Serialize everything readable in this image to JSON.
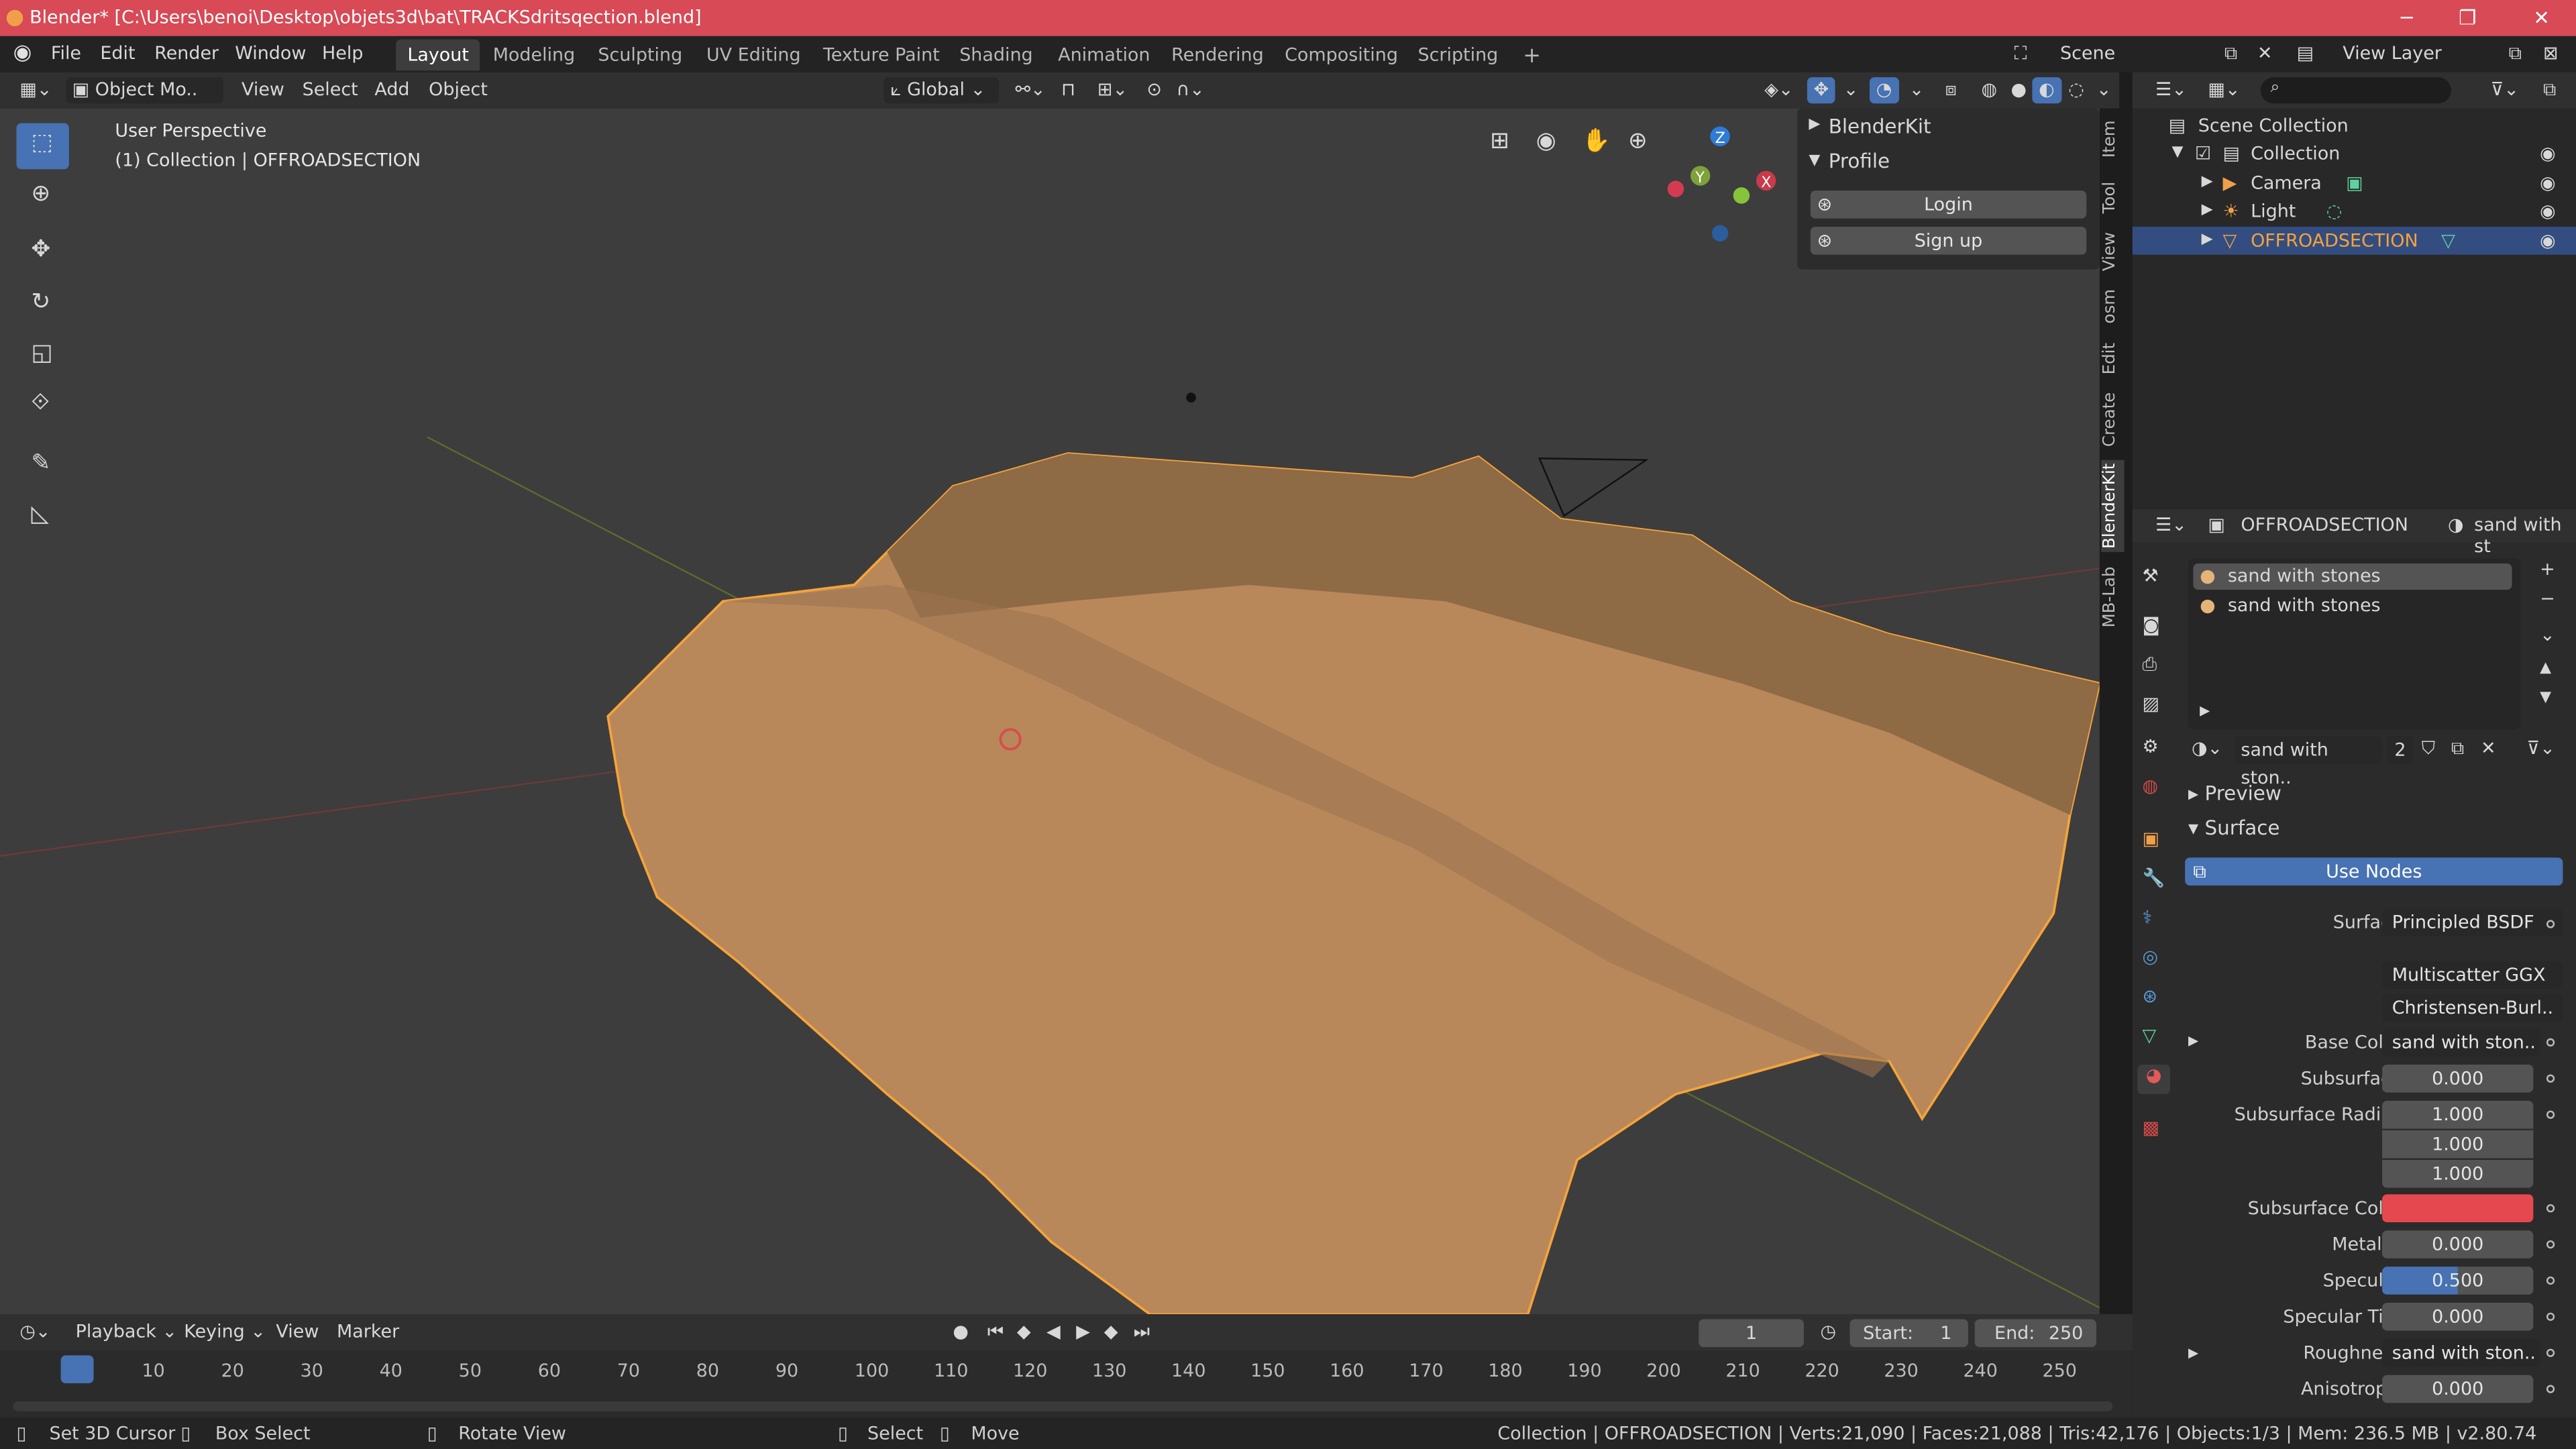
{
  "title_bar": {
    "title": "Blender* [C:\\Users\\benoi\\Desktop\\objets3d\\bat\\TRACKSdritsqection.blend]"
  },
  "menu": [
    "File",
    "Edit",
    "Render",
    "Window",
    "Help"
  ],
  "workspaces": [
    "Layout",
    "Modeling",
    "Sculpting",
    "UV Editing",
    "Texture Paint",
    "Shading",
    "Animation",
    "Rendering",
    "Compositing",
    "Scripting"
  ],
  "scene_name": "Scene",
  "view_layer_name": "View Layer",
  "viewport_header": {
    "mode": "Object Mo..",
    "menus": [
      "View",
      "Select",
      "Add",
      "Object"
    ],
    "transform_orientation": "Global"
  },
  "viewport": {
    "perspective_label": "User Perspective",
    "collection_label": "(1) Collection | OFFROADSECTION",
    "gizmo_axes": {
      "x": "X",
      "y": "Y",
      "z": "Z"
    }
  },
  "npanel": {
    "blenderkit_label": "BlenderKit",
    "profile_label": "Profile",
    "login_label": "Login",
    "signup_label": "Sign up"
  },
  "side_tabs": [
    "Item",
    "Tool",
    "View",
    "osm",
    "Edit",
    "Create",
    "BlenderKit",
    "MB-Lab"
  ],
  "outliner": {
    "scene_collection": "Scene Collection",
    "collection": "Collection",
    "items": [
      {
        "name": "Camera"
      },
      {
        "name": "Light"
      },
      {
        "name": "OFFROADSECTION"
      }
    ]
  },
  "properties": {
    "object_name": "OFFROADSECTION",
    "material_header": "sand with st",
    "slots": [
      "sand with stones",
      "sand with stones"
    ],
    "material_selector": "sand with ston..",
    "user_count": "2",
    "preview_label": "Preview",
    "surface_section": "Surface",
    "use_nodes_label": "Use Nodes",
    "surface_label": "Surface",
    "surface_value": "Principled BSDF",
    "distribution": "Multiscatter GGX",
    "subsurface_method": "Christensen-Burl..",
    "rows": {
      "base_color_label": "Base Color",
      "base_color_value": "sand with ston..",
      "subsurface_label": "Subsurface",
      "subsurface_value": "0.000",
      "subsurface_radius_label": "Subsurface Radius",
      "radius_1": "1.000",
      "radius_2": "1.000",
      "radius_3": "1.000",
      "subsurface_color_label": "Subsurface Color",
      "metallic_label": "Metallic",
      "metallic_value": "0.000",
      "specular_label": "Specular",
      "specular_value": "0.500",
      "specular_tint_label": "Specular Tint",
      "specular_tint_value": "0.000",
      "roughness_label": "Roughness",
      "roughness_value": "sand with ston..",
      "anisotropic_label": "Anisotropic",
      "anisotropic_value": "0.000"
    },
    "specular_fill": 0.5,
    "subsurface_color_hex": "#e5484f"
  },
  "timeline": {
    "menus": [
      "Playback",
      "Keying",
      "View",
      "Marker"
    ],
    "current_frame": "1",
    "start_label": "Start:",
    "start_value": "1",
    "end_label": "End:",
    "end_value": "250",
    "frame_labels": [
      "1",
      "10",
      "20",
      "30",
      "40",
      "50",
      "60",
      "70",
      "80",
      "90",
      "100",
      "110",
      "120",
      "130",
      "140",
      "150",
      "160",
      "170",
      "180",
      "190",
      "200",
      "210",
      "220",
      "230",
      "240",
      "250"
    ]
  },
  "status_bar": {
    "set_cursor": "Set 3D Cursor",
    "box_select": "Box Select",
    "rotate_view": "Rotate View",
    "select": "Select",
    "move": "Move",
    "stats": "Collection | OFFROADSECTION | Verts:21,090 | Faces:21,088 | Tris:42,176 | Objects:1/3 | Mem: 236.5 MB | v2.80.74"
  },
  "colors": {
    "accent": "#4772b3",
    "title_bar": "#d74a56",
    "selection_orange": "#f5a33b",
    "terrain": "#b8875a"
  }
}
